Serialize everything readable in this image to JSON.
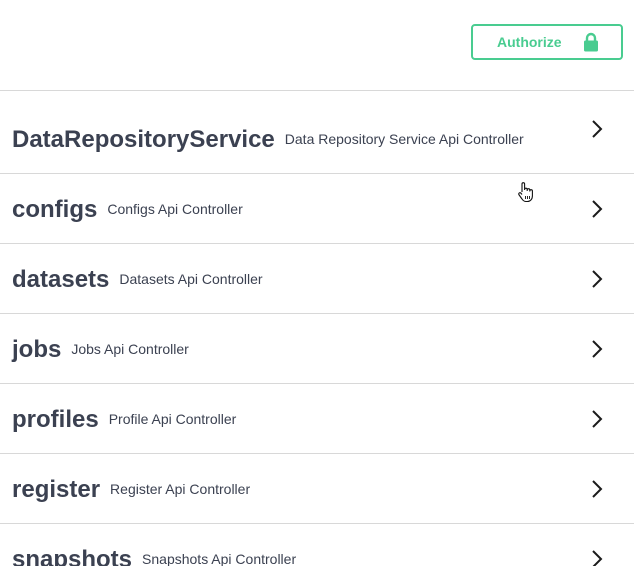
{
  "header": {
    "authorize_label": "Authorize",
    "lock_icon": "lock-icon",
    "accent_color": "#49cc90"
  },
  "sections": [
    {
      "tag": "DataRepositoryService",
      "description": "Data Repository Service Api Controller"
    },
    {
      "tag": "configs",
      "description": "Configs Api Controller"
    },
    {
      "tag": "datasets",
      "description": "Datasets Api Controller"
    },
    {
      "tag": "jobs",
      "description": "Jobs Api Controller"
    },
    {
      "tag": "profiles",
      "description": "Profile Api Controller"
    },
    {
      "tag": "register",
      "description": "Register Api Controller"
    },
    {
      "tag": "snapshots",
      "description": "Snapshots Api Controller"
    }
  ],
  "icons": {
    "expand": "chevron-right-icon",
    "pointer": "hand-cursor-icon"
  }
}
